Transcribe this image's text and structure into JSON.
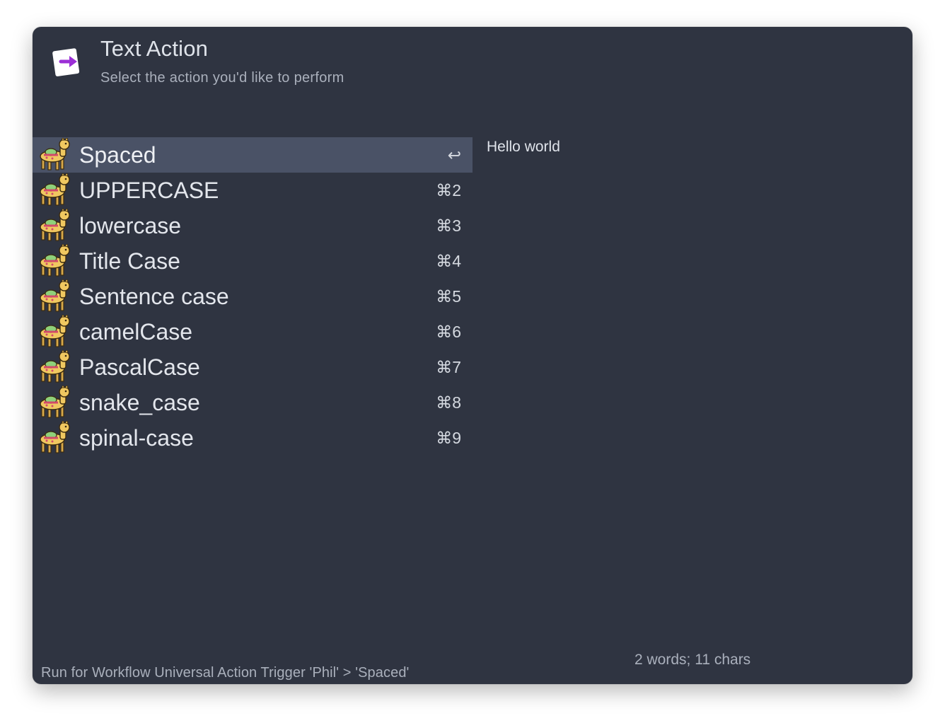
{
  "header": {
    "title": "Text Action",
    "subtitle": "Select the action you'd like to perform",
    "icon": "text-action-arrow-icon",
    "accent_color": "#9b2fd6"
  },
  "actions": [
    {
      "label": "Spaced",
      "shortcut": "↩",
      "selected": true
    },
    {
      "label": "UPPERCASE",
      "shortcut": "⌘2"
    },
    {
      "label": "lowercase",
      "shortcut": "⌘3"
    },
    {
      "label": "Title Case",
      "shortcut": "⌘4"
    },
    {
      "label": "Sentence case",
      "shortcut": "⌘5"
    },
    {
      "label": "camelCase",
      "shortcut": "⌘6"
    },
    {
      "label": "PascalCase",
      "shortcut": "⌘7"
    },
    {
      "label": "snake_case",
      "shortcut": "⌘8"
    },
    {
      "label": "spinal-case",
      "shortcut": "⌘9"
    }
  ],
  "action_icon": "llama-icon",
  "preview": {
    "text": "Hello world",
    "stats": "2 words; 11 chars"
  },
  "footer": {
    "text": "Run for Workflow Universal Action Trigger 'Phil' > 'Spaced'"
  },
  "colors": {
    "window_bg": "#2f3441",
    "selected_row_bg": "#4a5266",
    "text_primary": "#e3e6ec",
    "text_secondary": "#aab0bc"
  }
}
